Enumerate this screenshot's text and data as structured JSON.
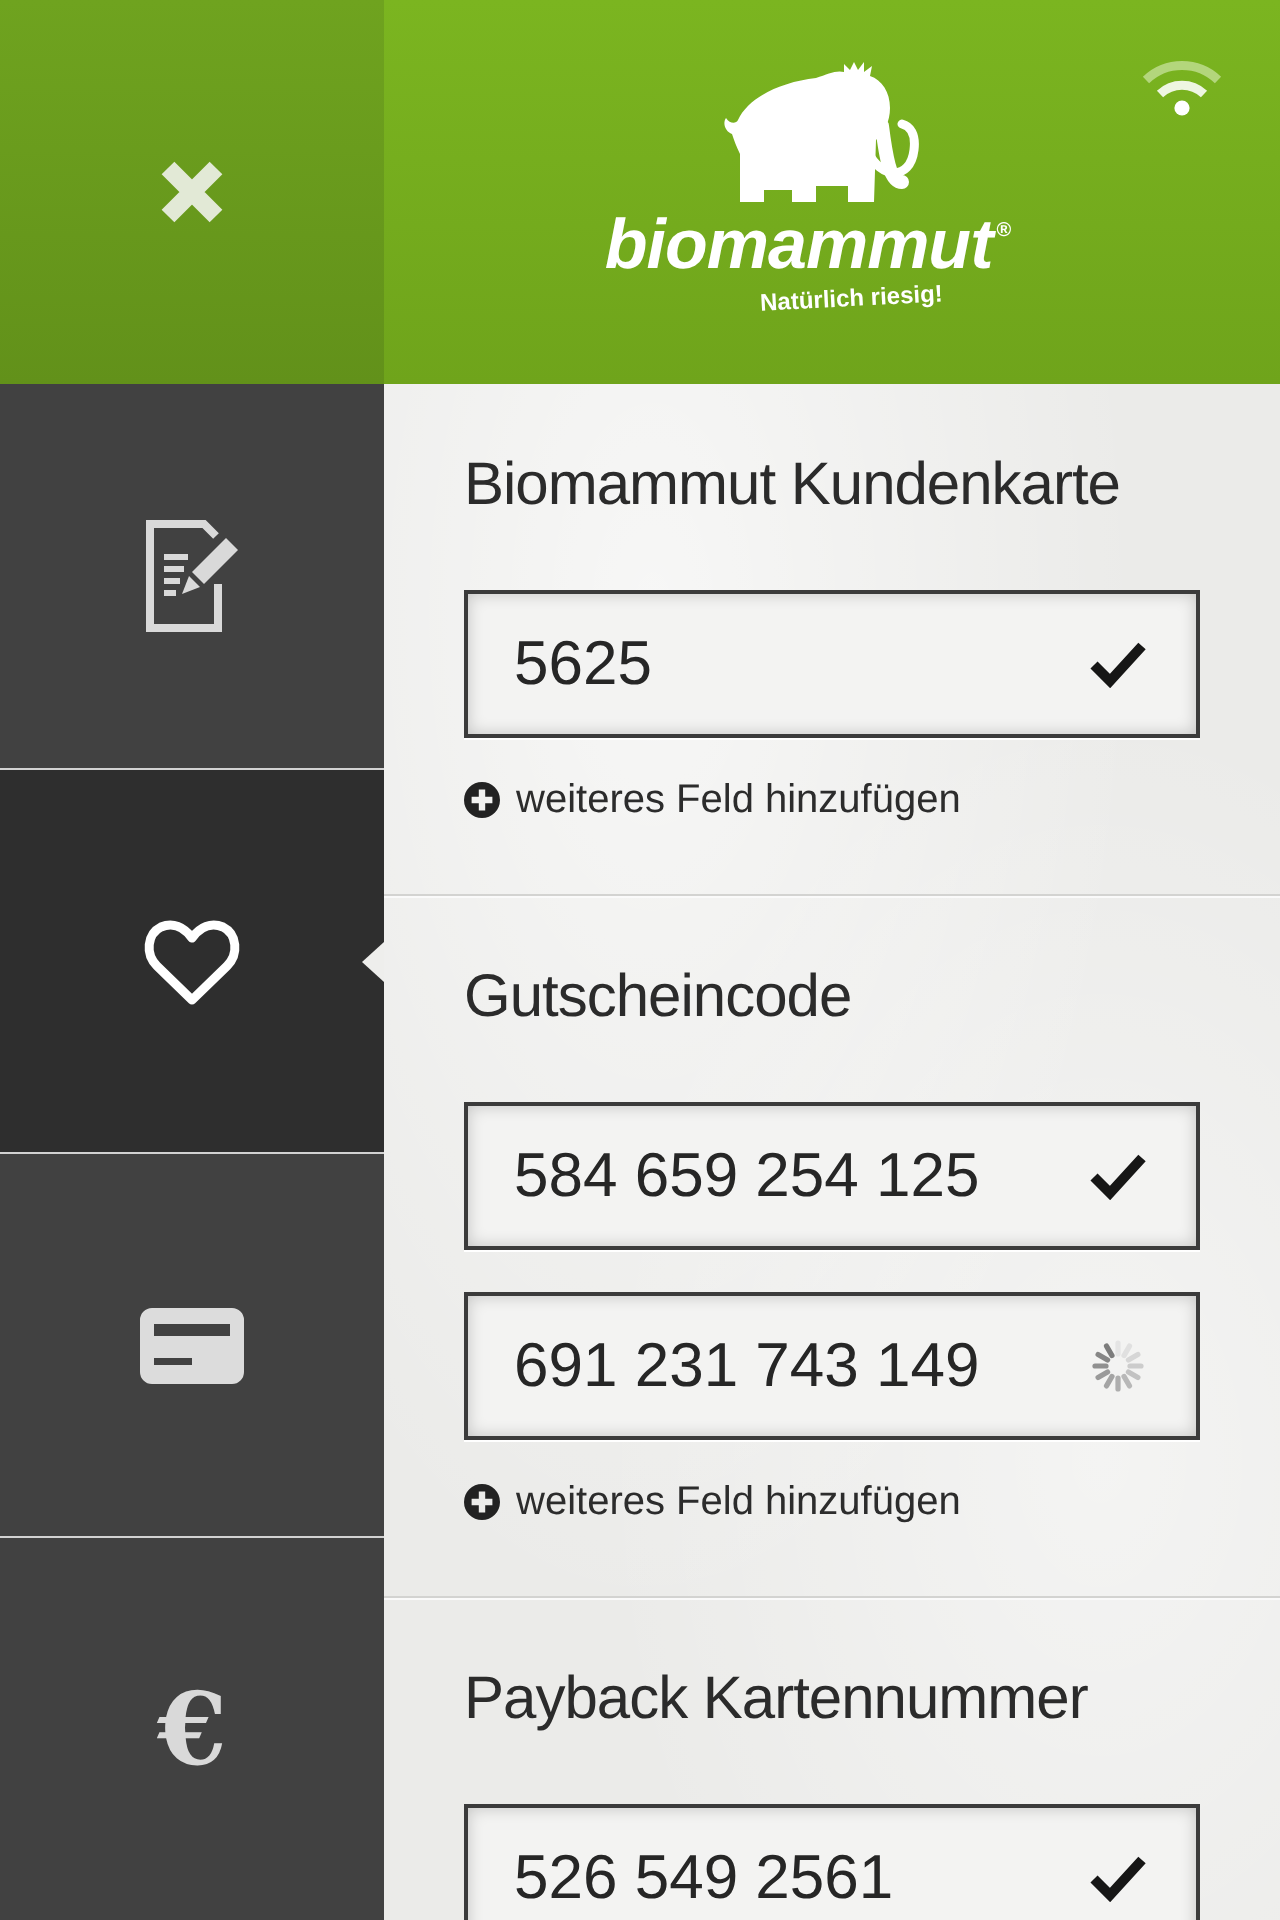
{
  "header": {
    "logo": {
      "name": "biomammut",
      "mark": "®",
      "tagline": "Natürlich riesig!"
    }
  },
  "sidebar": {
    "items": [
      {
        "kind": "icon",
        "selected": false
      },
      {
        "kind": "icon",
        "selected": true
      },
      {
        "kind": "icon",
        "selected": false
      },
      {
        "kind": "glyph",
        "label": "€",
        "selected": false
      }
    ]
  },
  "sections": [
    {
      "title": "Biomammut Kundenkarte",
      "fields": [
        {
          "value": "5625",
          "verified": true,
          "loading": false
        }
      ],
      "add_link": "weiteres Feld hinzufügen"
    },
    {
      "title": "Gutscheincode",
      "fields": [
        {
          "value": "584 659 254 125",
          "verified": true,
          "loading": false
        },
        {
          "value": "691 231 743 149",
          "verified": false,
          "loading": true
        }
      ],
      "add_link": "weiteres Feld hinzufügen"
    },
    {
      "title": "Payback Kartennummer",
      "fields": [
        {
          "value": "526 549 2561",
          "verified": true,
          "loading": false
        }
      ]
    }
  ]
}
